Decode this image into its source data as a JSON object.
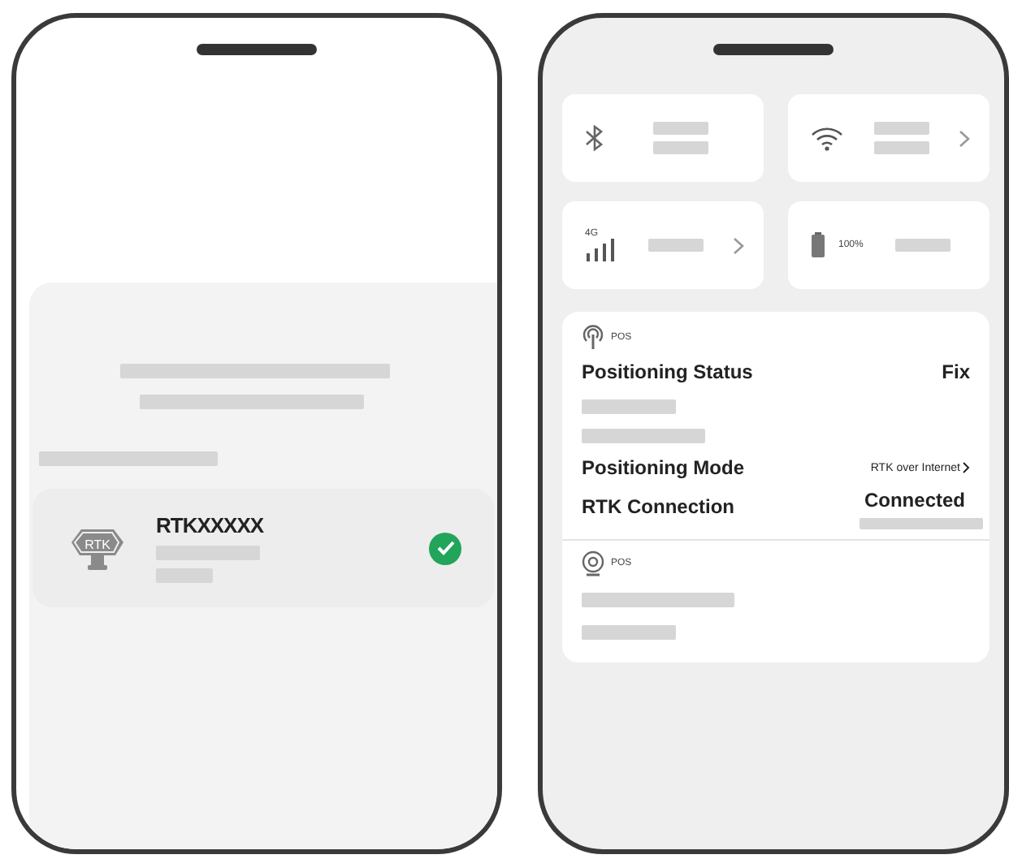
{
  "left_phone": {
    "device": {
      "badge": "RTK",
      "name": "RTKXXXXX",
      "connected": true
    }
  },
  "right_phone": {
    "tiles": [
      {
        "kind": "bluetooth",
        "chevron": false
      },
      {
        "kind": "wifi",
        "chevron": true
      },
      {
        "kind": "cellular",
        "network": "4G",
        "chevron": true
      },
      {
        "kind": "battery",
        "reading": "100%",
        "chevron": false
      }
    ],
    "positioning": {
      "header": "POS",
      "status_label": "Positioning Status",
      "status_value": "Fix",
      "mode_label": "Positioning Mode",
      "mode_value": "RTK over Internet",
      "connection_label": "RTK Connection",
      "connection_value": "Connected"
    },
    "camera": {
      "header": "POS"
    }
  }
}
